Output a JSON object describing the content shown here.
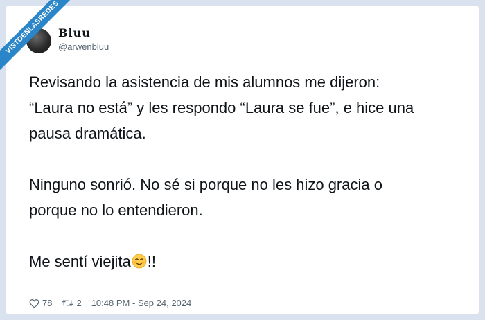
{
  "watermark": {
    "text": "VISTOENLASREDES"
  },
  "tweet": {
    "display_name": "Bluu",
    "handle": "@arwenbluu",
    "paragraphs": [
      "Revisando la asistencia de mis alumnos me dijeron:\n“Laura no está” y les respondo “Laura se fue”, e hice una\npausa dramática.",
      "Ninguno sonrió. No sé si porque no les hizo gracia o\nporque no lo entendieron."
    ],
    "last_line_before": "Me sentí viejita",
    "last_line_after": "!!",
    "emoji_icon": "smiling-face-emoji",
    "likes": "78",
    "retweets": "2",
    "timestamp": "10:48 PM - Sep 24, 2024"
  },
  "colors": {
    "background": "#d9e2ee",
    "text": "#0f1419",
    "secondary": "#536471",
    "ribbon": "#2a86c8"
  }
}
